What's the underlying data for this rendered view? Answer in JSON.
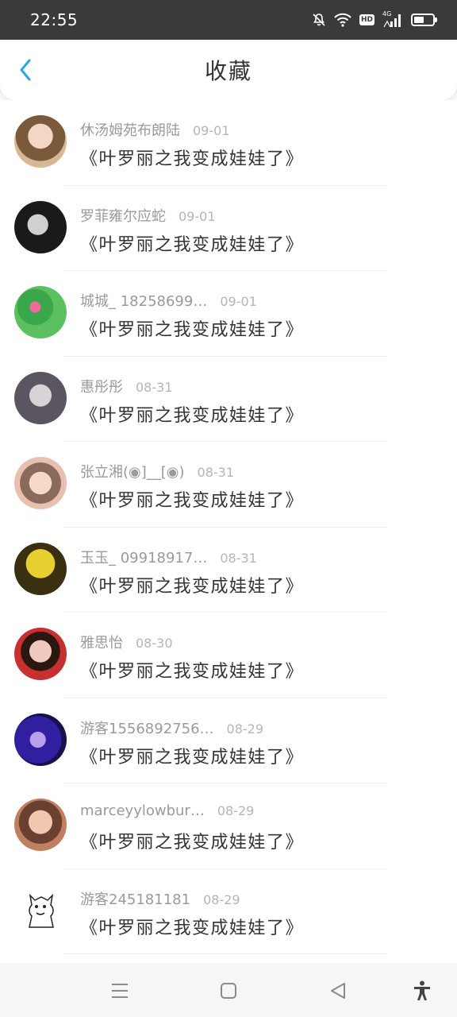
{
  "status_bar": {
    "time": "22:55",
    "hd_label": "HD",
    "network_label": "4G",
    "battery_percent": 55,
    "icons": [
      "bell-muted-icon",
      "wifi-icon",
      "hd-icon",
      "signal-icon",
      "battery-icon"
    ]
  },
  "header": {
    "title": "收藏",
    "back_icon": "chevron-left-icon",
    "accent_color": "#2aa7e6"
  },
  "items": [
    {
      "name": "休汤姆苑布朗陆",
      "date": "09-01",
      "content": "《叶罗丽之我变成娃娃了》"
    },
    {
      "name": "罗菲雍尔应蛇",
      "date": "09-01",
      "content": "《叶罗丽之我变成娃娃了》"
    },
    {
      "name": "城城_ 18258699…",
      "date": "09-01",
      "content": "《叶罗丽之我变成娃娃了》"
    },
    {
      "name": "惠彤彤",
      "date": "08-31",
      "content": "《叶罗丽之我变成娃娃了》"
    },
    {
      "name": "张立湘(◉]__[◉)",
      "date": "08-31",
      "content": "《叶罗丽之我变成娃娃了》"
    },
    {
      "name": "玉玉_ 09918917…",
      "date": "08-31",
      "content": "《叶罗丽之我变成娃娃了》"
    },
    {
      "name": "雅思怡",
      "date": "08-30",
      "content": "《叶罗丽之我变成娃娃了》"
    },
    {
      "name": "游客1556892756…",
      "date": "08-29",
      "content": "《叶罗丽之我变成娃娃了》"
    },
    {
      "name": "marceyylowbur…",
      "date": "08-29",
      "content": "《叶罗丽之我变成娃娃了》"
    },
    {
      "name": "游客245181181",
      "date": "08-29",
      "content": "《叶罗丽之我变成娃娃了》"
    }
  ],
  "nav_bar": {
    "icons": [
      "menu-icon",
      "home-square-icon",
      "back-triangle-icon",
      "accessibility-icon"
    ]
  }
}
